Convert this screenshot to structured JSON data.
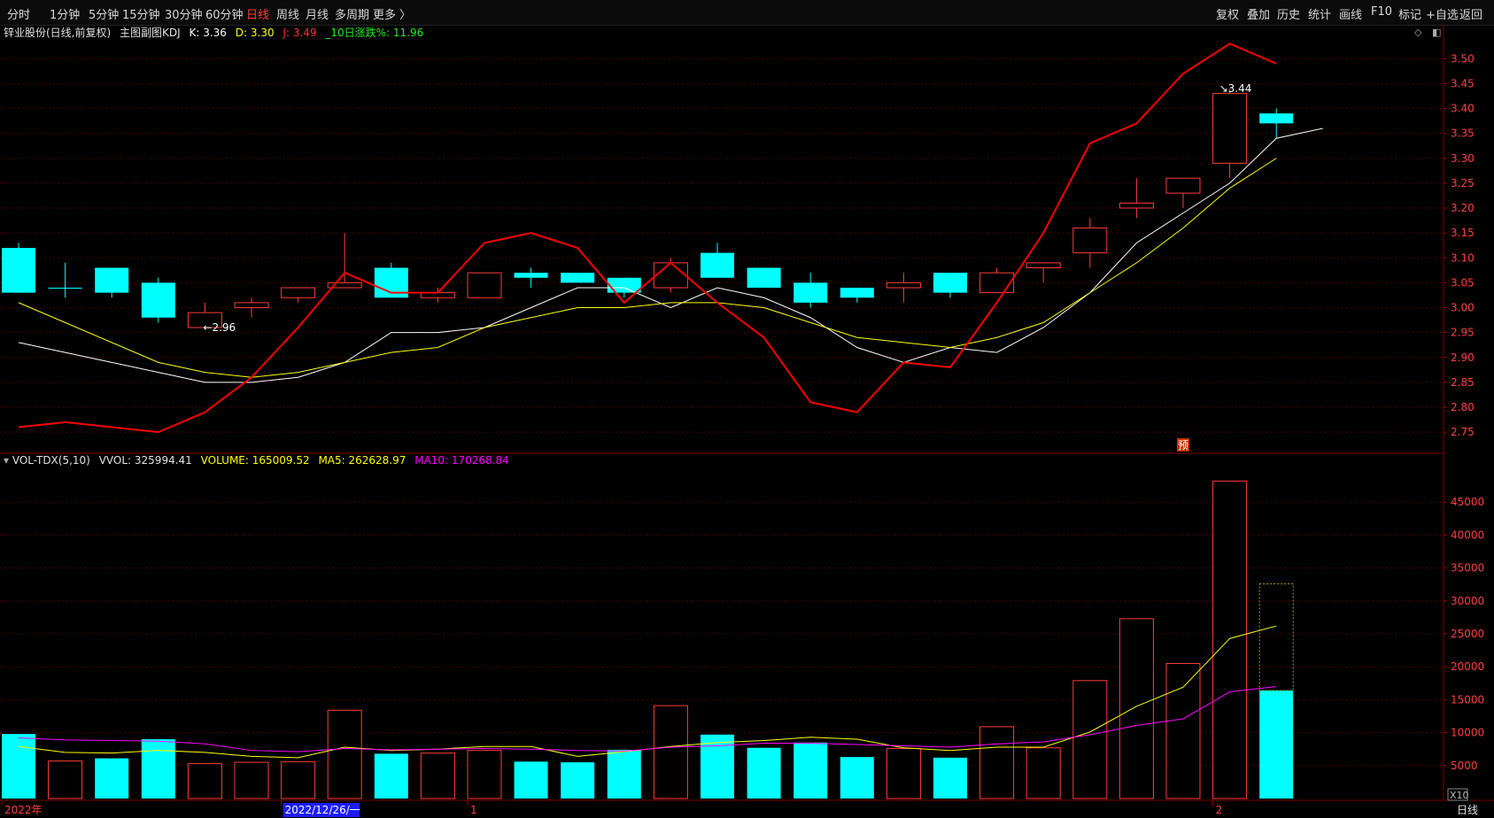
{
  "toolbar": {
    "periods": [
      "分时",
      "1分钟",
      "5分钟",
      "15分钟",
      "30分钟",
      "60分钟",
      "日线",
      "周线",
      "月线",
      "多周期",
      "更多 〉"
    ],
    "active": "日线",
    "right_buttons": [
      "复权",
      "叠加",
      "历史",
      "统计",
      "画线",
      "F10",
      "标记",
      "+自选",
      "返回"
    ]
  },
  "main_panel": {
    "stock_label": "锌业股份(日线,前复权)",
    "indicator_label": "主图副图KDJ",
    "k_text": "K: 3.36",
    "d_text": "D: 3.30",
    "j_text": "J: 3.49",
    "chg_text": "_10日涨跌%: 11.96",
    "low_marker": "2.96",
    "high_marker": "3.44",
    "pre_badge": "预"
  },
  "vol_panel": {
    "name": "VOL-TDX(5,10)",
    "vvol": "VVOL: 325994.41",
    "volume": "VOLUME: 165009.52",
    "ma5": "MA5: 262628.97",
    "ma10": "MA10: 170268.84",
    "scale": "X10"
  },
  "xaxis": {
    "labels": [
      "2022年",
      "2022/12/26/一",
      "1",
      "2"
    ],
    "label_index": [
      0,
      6,
      10,
      26
    ],
    "period_label": "日线"
  },
  "colors": {
    "up": "#ff3b3b",
    "down": "#00ffff",
    "k": "#ffffff",
    "d": "#ffff00",
    "j": "#ff0000",
    "ma5": "#ffff00",
    "ma10": "#ff00ff",
    "grid": "#4a0000"
  },
  "chart_data": [
    {
      "type": "candlestick",
      "ylim": [
        2.72,
        3.52
      ],
      "y_ticks": [
        2.75,
        2.8,
        2.85,
        2.9,
        2.95,
        3.0,
        3.05,
        3.1,
        3.15,
        3.2,
        3.25,
        3.3,
        3.35,
        3.4,
        3.45,
        3.5
      ],
      "candles": [
        {
          "o": 3.12,
          "h": 3.13,
          "l": 3.03,
          "c": 3.03,
          "up": false
        },
        {
          "o": 3.04,
          "h": 3.09,
          "l": 3.02,
          "c": 3.04,
          "up": false
        },
        {
          "o": 3.08,
          "h": 3.08,
          "l": 3.02,
          "c": 3.03,
          "up": false
        },
        {
          "o": 3.05,
          "h": 3.06,
          "l": 2.97,
          "c": 2.98,
          "up": false
        },
        {
          "o": 2.96,
          "h": 3.01,
          "l": 2.96,
          "c": 2.99,
          "up": true
        },
        {
          "o": 3.0,
          "h": 3.02,
          "l": 2.98,
          "c": 3.01,
          "up": true
        },
        {
          "o": 3.02,
          "h": 3.04,
          "l": 3.01,
          "c": 3.04,
          "up": true
        },
        {
          "o": 3.04,
          "h": 3.15,
          "l": 3.04,
          "c": 3.05,
          "up": true
        },
        {
          "o": 3.08,
          "h": 3.09,
          "l": 3.02,
          "c": 3.02,
          "up": false
        },
        {
          "o": 3.02,
          "h": 3.04,
          "l": 3.01,
          "c": 3.03,
          "up": true
        },
        {
          "o": 3.02,
          "h": 3.07,
          "l": 3.02,
          "c": 3.07,
          "up": true
        },
        {
          "o": 3.07,
          "h": 3.08,
          "l": 3.04,
          "c": 3.06,
          "up": false
        },
        {
          "o": 3.07,
          "h": 3.07,
          "l": 3.05,
          "c": 3.05,
          "up": false
        },
        {
          "o": 3.06,
          "h": 3.06,
          "l": 3.02,
          "c": 3.03,
          "up": false
        },
        {
          "o": 3.04,
          "h": 3.1,
          "l": 3.03,
          "c": 3.09,
          "up": true
        },
        {
          "o": 3.11,
          "h": 3.13,
          "l": 3.06,
          "c": 3.06,
          "up": false
        },
        {
          "o": 3.08,
          "h": 3.08,
          "l": 3.04,
          "c": 3.04,
          "up": false
        },
        {
          "o": 3.05,
          "h": 3.07,
          "l": 3.0,
          "c": 3.01,
          "up": false
        },
        {
          "o": 3.04,
          "h": 3.04,
          "l": 3.01,
          "c": 3.02,
          "up": false
        },
        {
          "o": 3.04,
          "h": 3.07,
          "l": 3.01,
          "c": 3.05,
          "up": true
        },
        {
          "o": 3.07,
          "h": 3.07,
          "l": 3.02,
          "c": 3.03,
          "up": false
        },
        {
          "o": 3.03,
          "h": 3.08,
          "l": 3.03,
          "c": 3.07,
          "up": true
        },
        {
          "o": 3.08,
          "h": 3.09,
          "l": 3.05,
          "c": 3.09,
          "up": true
        },
        {
          "o": 3.11,
          "h": 3.18,
          "l": 3.08,
          "c": 3.16,
          "up": true
        },
        {
          "o": 3.2,
          "h": 3.26,
          "l": 3.18,
          "c": 3.21,
          "up": true
        },
        {
          "o": 3.23,
          "h": 3.26,
          "l": 3.2,
          "c": 3.26,
          "up": true
        },
        {
          "o": 3.29,
          "h": 3.44,
          "l": 3.26,
          "c": 3.43,
          "up": true
        },
        {
          "o": 3.39,
          "h": 3.4,
          "l": 3.34,
          "c": 3.37,
          "up": false
        }
      ],
      "series": [
        {
          "name": "K",
          "values": [
            2.93,
            2.91,
            2.89,
            2.87,
            2.85,
            2.85,
            2.86,
            2.89,
            2.95,
            2.95,
            2.96,
            3.0,
            3.04,
            3.04,
            3.0,
            3.04,
            3.02,
            2.98,
            2.92,
            2.89,
            2.92,
            2.91,
            2.96,
            3.03,
            3.13,
            3.19,
            3.25,
            3.34,
            3.36
          ]
        },
        {
          "name": "D",
          "values": [
            3.01,
            2.97,
            2.93,
            2.89,
            2.87,
            2.86,
            2.87,
            2.89,
            2.91,
            2.92,
            2.96,
            2.98,
            3.0,
            3.0,
            3.01,
            3.01,
            3.0,
            2.97,
            2.94,
            2.93,
            2.92,
            2.94,
            2.97,
            3.03,
            3.09,
            3.16,
            3.24,
            3.3
          ]
        },
        {
          "name": "J",
          "values": [
            2.76,
            2.77,
            2.76,
            2.75,
            2.79,
            2.86,
            2.96,
            3.07,
            3.03,
            3.03,
            3.13,
            3.15,
            3.12,
            3.01,
            3.09,
            3.01,
            2.94,
            2.81,
            2.79,
            2.89,
            2.88,
            3.01,
            3.15,
            3.33,
            3.37,
            3.47,
            3.53,
            3.49
          ]
        }
      ]
    },
    {
      "type": "bar",
      "unit_scale": "X10",
      "ylim": [
        0,
        50000
      ],
      "y_ticks": [
        5000,
        10000,
        15000,
        20000,
        25000,
        30000,
        35000,
        40000,
        45000
      ],
      "values": [
        9800,
        5700,
        6100,
        9000,
        5300,
        5500,
        5600,
        13400,
        6800,
        6900,
        7300,
        5600,
        5500,
        7400,
        14100,
        9700,
        7700,
        8500,
        6300,
        7600,
        6200,
        10900,
        7700,
        17900,
        27300,
        20500,
        48200,
        16400
      ],
      "up": [
        false,
        true,
        false,
        false,
        true,
        true,
        true,
        true,
        false,
        true,
        true,
        false,
        false,
        false,
        true,
        false,
        false,
        false,
        false,
        true,
        false,
        true,
        true,
        true,
        true,
        true,
        true,
        false
      ],
      "ghost_value": 32600,
      "series": [
        {
          "name": "MA5",
          "values": [
            7900,
            7000,
            6900,
            7300,
            7000,
            6400,
            6200,
            7800,
            7300,
            7500,
            7900,
            7900,
            6400,
            7100,
            7900,
            8500,
            8800,
            9300,
            9000,
            7700,
            7300,
            7800,
            7800,
            10100,
            14000,
            16900,
            24300,
            26200
          ]
        },
        {
          "name": "MA10",
          "values": [
            9200,
            8900,
            8800,
            8700,
            8300,
            7300,
            7100,
            7600,
            7400,
            7500,
            7600,
            7500,
            7300,
            7200,
            7800,
            8000,
            8400,
            8400,
            8200,
            8000,
            7800,
            8300,
            8600,
            9700,
            11100,
            12100,
            16200,
            17000
          ]
        }
      ]
    }
  ]
}
